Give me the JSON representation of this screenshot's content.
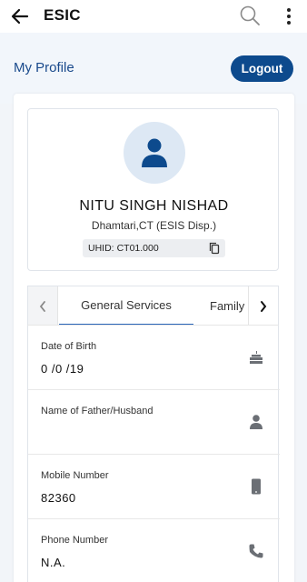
{
  "appbar": {
    "title": "ESIC",
    "back_icon": "arrow-left-icon",
    "search_icon": "search-icon",
    "menu_icon": "more-vertical-icon"
  },
  "profile_header": {
    "heading": "My Profile",
    "logout_label": "Logout"
  },
  "profile": {
    "name": "NITU SINGH NISHAD",
    "location": "Dhamtari,CT (ESIS Disp.)",
    "uhid_label": "UHID:",
    "uhid_value": "CT01.000",
    "copy_icon": "copy-icon",
    "avatar_icon": "person-icon"
  },
  "tabs": {
    "items": [
      "General Services",
      "Family"
    ],
    "active": "General Services"
  },
  "details": [
    {
      "label": "Date of Birth",
      "value": "0 /0 /19",
      "icon": "cake-icon"
    },
    {
      "label": "Name of Father/Husband",
      "value": "",
      "icon": "person-icon"
    },
    {
      "label": "Mobile Number",
      "value": "82360",
      "icon": "smartphone-icon"
    },
    {
      "label": "Phone Number",
      "value": "N.A.",
      "icon": "phone-icon"
    }
  ],
  "colors": {
    "primary": "#0d4a8d",
    "heading": "#1a4a8c",
    "tab_indicator": "#2a66b8",
    "avatar_bg": "#dde8f4",
    "icon_gray": "#6b6f75"
  }
}
